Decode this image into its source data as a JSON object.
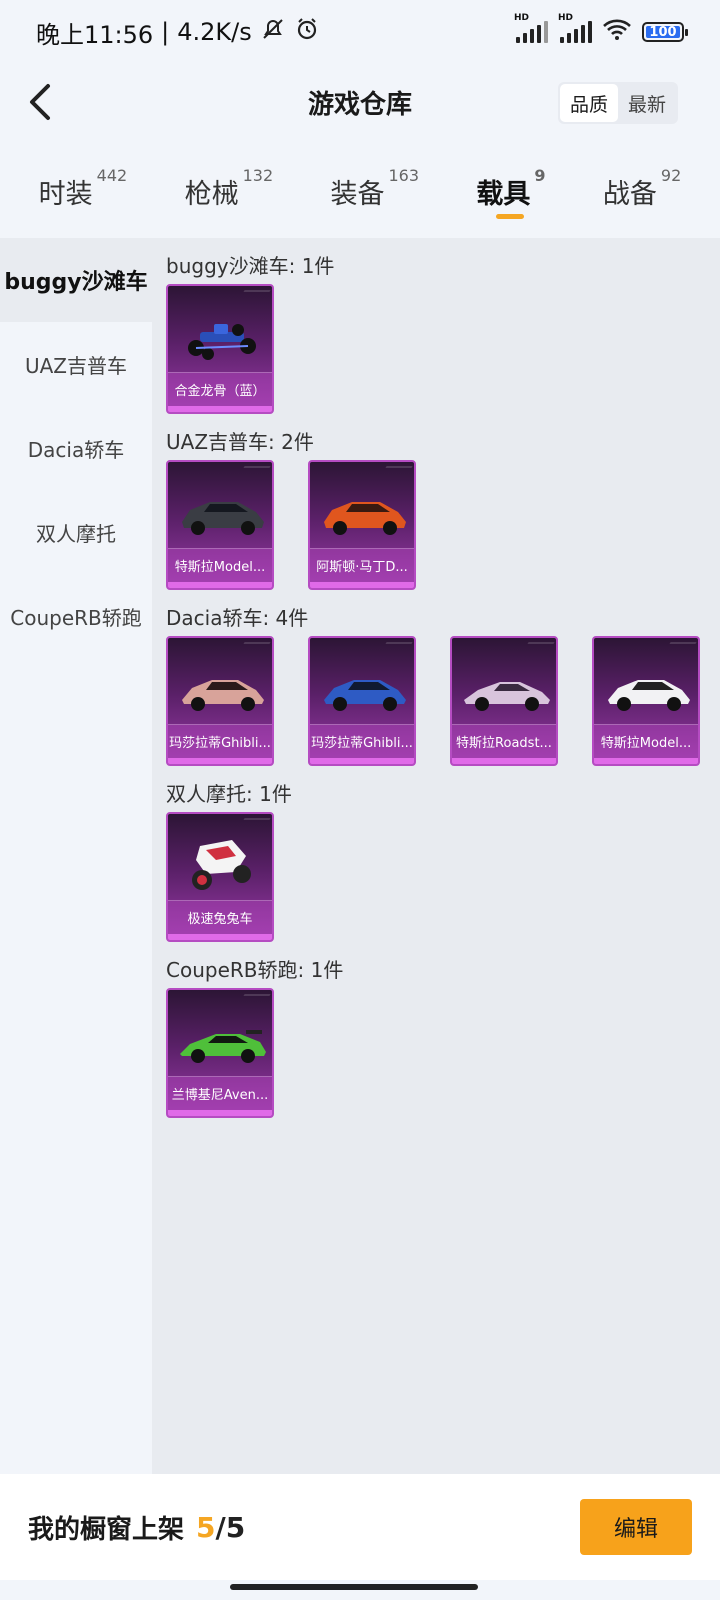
{
  "status_bar": {
    "time": "晚上11:56",
    "net_speed": "4.2K/s",
    "signal1": "HD",
    "signal2": "HD",
    "battery": "100"
  },
  "header": {
    "title": "游戏仓库",
    "sort_options": [
      "品质",
      "最新"
    ],
    "sort_selected": "品质"
  },
  "tabs": [
    {
      "label": "时装",
      "count": "442"
    },
    {
      "label": "枪械",
      "count": "132"
    },
    {
      "label": "装备",
      "count": "163"
    },
    {
      "label": "载具",
      "count": "9"
    },
    {
      "label": "战备",
      "count": "92"
    }
  ],
  "active_tab": "载具",
  "sidebar": {
    "items": [
      "buggy沙滩车",
      "UAZ吉普车",
      "Dacia轿车",
      "双人摩托",
      "CoupeRB轿跑"
    ],
    "active": "buggy沙滩车"
  },
  "groups": [
    {
      "title": "buggy沙滩车: 1件",
      "items": [
        "合金龙骨（蓝）"
      ]
    },
    {
      "title": "UAZ吉普车: 2件",
      "items": [
        "特斯拉Model...",
        "阿斯顿·马丁D..."
      ]
    },
    {
      "title": "Dacia轿车: 4件",
      "items": [
        "玛莎拉蒂Ghibli...",
        "玛莎拉蒂Ghibli...",
        "特斯拉Roadst...",
        "特斯拉Model..."
      ]
    },
    {
      "title": "双人摩托: 1件",
      "items": [
        "极速兔兔车"
      ]
    },
    {
      "title": "CoupeRB轿跑: 1件",
      "items": [
        "兰博基尼Aven..."
      ]
    }
  ],
  "bottom": {
    "shelf_label": "我的橱窗上架",
    "used": "5",
    "separator": "/",
    "total": "5",
    "edit_label": "编辑"
  },
  "colors": {
    "accent": "#f5a623",
    "card_purple": "#9a3aa8",
    "edit_button": "#f7a21b"
  }
}
